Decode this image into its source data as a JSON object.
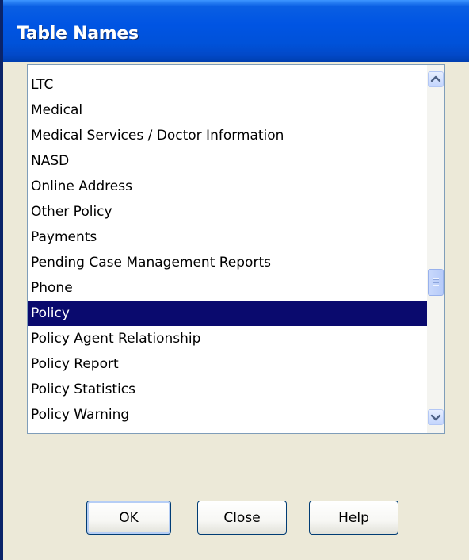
{
  "window": {
    "title": "Table Names"
  },
  "list": {
    "items": [
      "LTC",
      "Medical",
      "Medical Services / Doctor Information",
      "NASD",
      "Online Address",
      "Other Policy",
      "Payments",
      "Pending Case Management Reports",
      "Phone",
      "Policy",
      "Policy Agent Relationship",
      "Policy Report",
      "Policy Statistics",
      "Policy Warning"
    ],
    "selected": "Policy"
  },
  "scrollbar": {
    "up_icon": "chevron-up-icon",
    "down_icon": "chevron-down-icon"
  },
  "buttons": {
    "ok_label": "OK",
    "close_label": "Close",
    "help_label": "Help"
  },
  "colors": {
    "titlebar": "#0054e3",
    "selection": "#0a0a6e",
    "dialog_bg": "#ece9d8"
  }
}
